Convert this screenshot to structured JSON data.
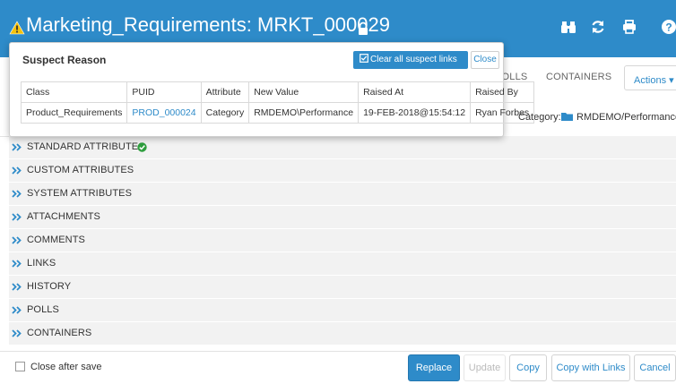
{
  "header": {
    "title": "Marketing_Requirements: MRKT_000029",
    "icons": [
      "warning-icon",
      "lock-icon",
      "binoculars-icon",
      "refresh-icon",
      "print-icon",
      "help-icon"
    ]
  },
  "subbar": {
    "tabs": [
      "POLLS",
      "CONTAINERS"
    ],
    "actions_label": "Actions ▾"
  },
  "category": {
    "label": "Category:",
    "value": "RMDEMO/Performance ▼"
  },
  "sections": [
    {
      "label": "STANDARD ATTRIBUTES"
    },
    {
      "label": "CUSTOM ATTRIBUTES"
    },
    {
      "label": "SYSTEM ATTRIBUTES"
    },
    {
      "label": "ATTACHMENTS"
    },
    {
      "label": "COMMENTS"
    },
    {
      "label": "LINKS"
    },
    {
      "label": "HISTORY"
    },
    {
      "label": "POLLS"
    },
    {
      "label": "CONTAINERS"
    }
  ],
  "footer": {
    "close_after_save": "Close after save",
    "replace": "Replace",
    "update": "Update",
    "copy": "Copy",
    "copy_with_links": "Copy with Links",
    "cancel": "Cancel"
  },
  "popup": {
    "title": "Suspect Reason",
    "clear_label": "Clear all suspect links",
    "close_label": "Close",
    "columns": [
      "Class",
      "PUID",
      "Attribute",
      "New Value",
      "Raised At",
      "Raised By"
    ],
    "rows": [
      [
        "Product_Requirements",
        "PROD_000024",
        "Category",
        "RMDEMO\\Performance",
        "19-FEB-2018@15:54:12",
        "Ryan Forbes"
      ]
    ]
  },
  "colors": {
    "brand": "#2e8bc9",
    "warning": "#f4c20d",
    "success": "#2e9e3e"
  }
}
